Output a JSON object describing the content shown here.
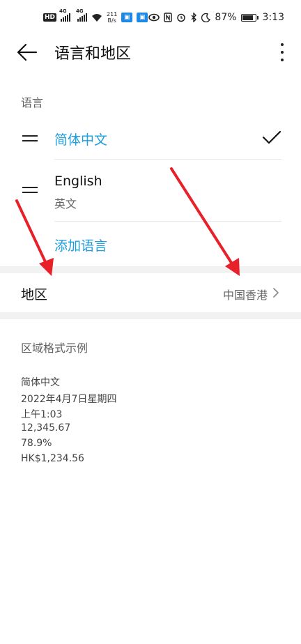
{
  "status_bar": {
    "hd_label": "HD",
    "net1": "4G",
    "net2": "4G",
    "speed_value": "211",
    "speed_unit": "B/s",
    "battery_percent": "87%",
    "battery_level": 0.87,
    "time": "3:13"
  },
  "header": {
    "title": "语言和地区"
  },
  "language_section": {
    "label": "语言",
    "languages": [
      {
        "name": "简体中文",
        "selected": true
      },
      {
        "name": "English",
        "subtitle": "英文",
        "selected": false
      }
    ],
    "add_label": "添加语言"
  },
  "region": {
    "label": "地区",
    "value": "中国香港"
  },
  "format_sample": {
    "title": "区域格式示例",
    "lines": [
      "简体中文",
      "2022年4月7日星期四",
      "上午1:03",
      "12,345.67",
      "78.9%",
      "HK$1,234.56"
    ]
  },
  "colors": {
    "accent": "#1e9fe0",
    "annotation_arrow": "#e8202a"
  }
}
